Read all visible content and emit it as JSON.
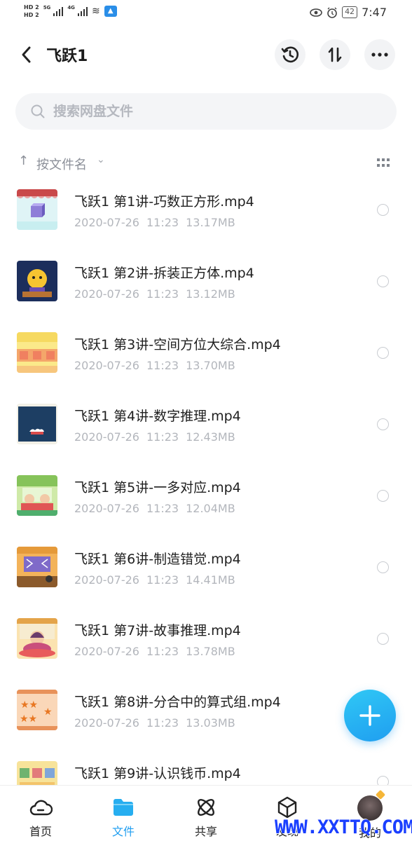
{
  "status_bar": {
    "hd1": "HD 2",
    "hd2": "HD 2",
    "net1": "5G",
    "net2": "4G",
    "battery": "42",
    "time": "7:47"
  },
  "header": {
    "title": "飞跃1"
  },
  "search": {
    "placeholder": "搜索网盘文件"
  },
  "sort": {
    "label": "按文件名"
  },
  "files": [
    {
      "name": "飞跃1 第1讲-巧数正方形.mp4",
      "date": "2020-07-26",
      "time": "11:23",
      "size": "13.17MB"
    },
    {
      "name": "飞跃1 第2讲-拆装正方体.mp4",
      "date": "2020-07-26",
      "time": "11:23",
      "size": "13.12MB"
    },
    {
      "name": "飞跃1 第3讲-空间方位大综合.mp4",
      "date": "2020-07-26",
      "time": "11:23",
      "size": "13.70MB"
    },
    {
      "name": "飞跃1 第4讲-数字推理.mp4",
      "date": "2020-07-26",
      "time": "11:23",
      "size": "12.43MB"
    },
    {
      "name": "飞跃1 第5讲-一多对应.mp4",
      "date": "2020-07-26",
      "time": "11:23",
      "size": "12.04MB"
    },
    {
      "name": "飞跃1 第6讲-制造错觉.mp4",
      "date": "2020-07-26",
      "time": "11:23",
      "size": "14.41MB"
    },
    {
      "name": "飞跃1 第7讲-故事推理.mp4",
      "date": "2020-07-26",
      "time": "11:23",
      "size": "13.78MB"
    },
    {
      "name": "飞跃1 第8讲-分合中的算式组.mp4",
      "date": "2020-07-26",
      "time": "11:23",
      "size": "13.03MB"
    },
    {
      "name": "飞跃1 第9讲-认识钱币.mp4",
      "date": "",
      "time": "",
      "size": ""
    }
  ],
  "nav": {
    "home": "首页",
    "files": "文件",
    "share": "共享",
    "discover": "发现",
    "me": "我的"
  },
  "watermark": "WWW.XXTTQ.COM",
  "colors": {
    "accent": "#1f9ef0",
    "meta_text": "#b3b6bc"
  }
}
